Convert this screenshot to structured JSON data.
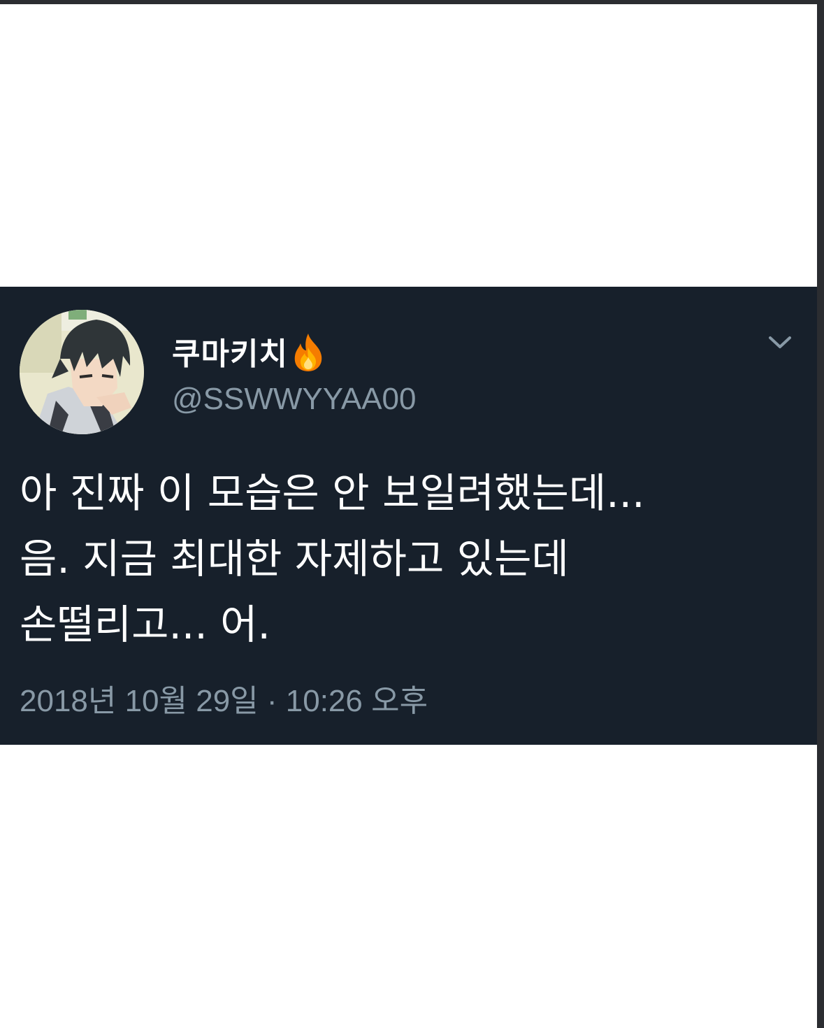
{
  "tweet": {
    "display_name": "쿠마키치",
    "name_emoji_icon": "fire-icon",
    "handle": "@SSWWYYAA00",
    "menu_icon": "chevron-down-icon",
    "lines": [
      "아 진짜 이 모습은 안 보일려했는데...",
      "음. 지금 최대한 자제하고 있는데",
      "손떨리고... 어."
    ],
    "timestamp": "2018년 10월 29일 · 10:26 오후"
  },
  "colors": {
    "card_background": "#17202b",
    "secondary_text": "#8899a6",
    "primary_text": "#ffffff"
  }
}
